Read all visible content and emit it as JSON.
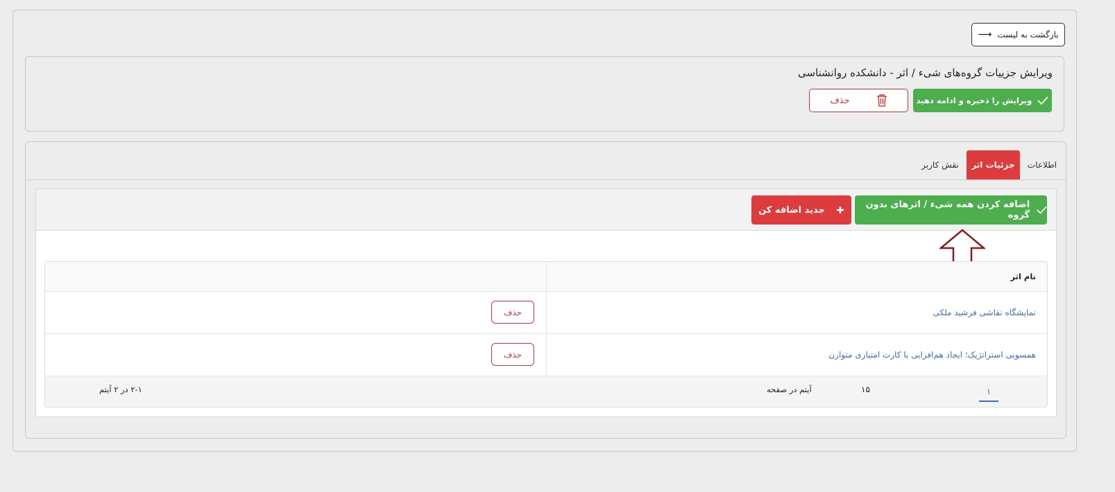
{
  "back": {
    "label": "بازگشت به لیست",
    "icon": "arrow-right-icon"
  },
  "header": {
    "title": "ویرایش جزییات گروه‌های شیء / اثر - دانشکده روانشناسی",
    "save_label": "ویرایش را ذخیره و ادامه دهید",
    "delete_label": "حذف"
  },
  "tabs": [
    {
      "label": "اطلاعات"
    },
    {
      "label": "جزئیات اثر"
    },
    {
      "label": "نقش کاربر"
    }
  ],
  "toolbar": {
    "add_all_label": "اضافه کردن همه شیء / اثرهای بدون گروه",
    "add_new_label": "جدید اضافه کن"
  },
  "grid": {
    "column_name": "نام اثر",
    "rows": [
      {
        "name": "نمایشگاه نقاشی فرشید ملکی",
        "action": "حذف"
      },
      {
        "name": "همسویی استراتژیک؛ ایجاد هم‌افزایی با کارت امتیازی متوازن",
        "action": "حذف"
      }
    ]
  },
  "pager": {
    "current_page": "۱",
    "page_size": "۱۵",
    "page_size_label": "آیتم در صفحه",
    "info": "۲-۱ در ۲ آیتم"
  },
  "colors": {
    "green": "#4cae4c",
    "red": "#de3c3c",
    "link": "#3b6fb6"
  }
}
